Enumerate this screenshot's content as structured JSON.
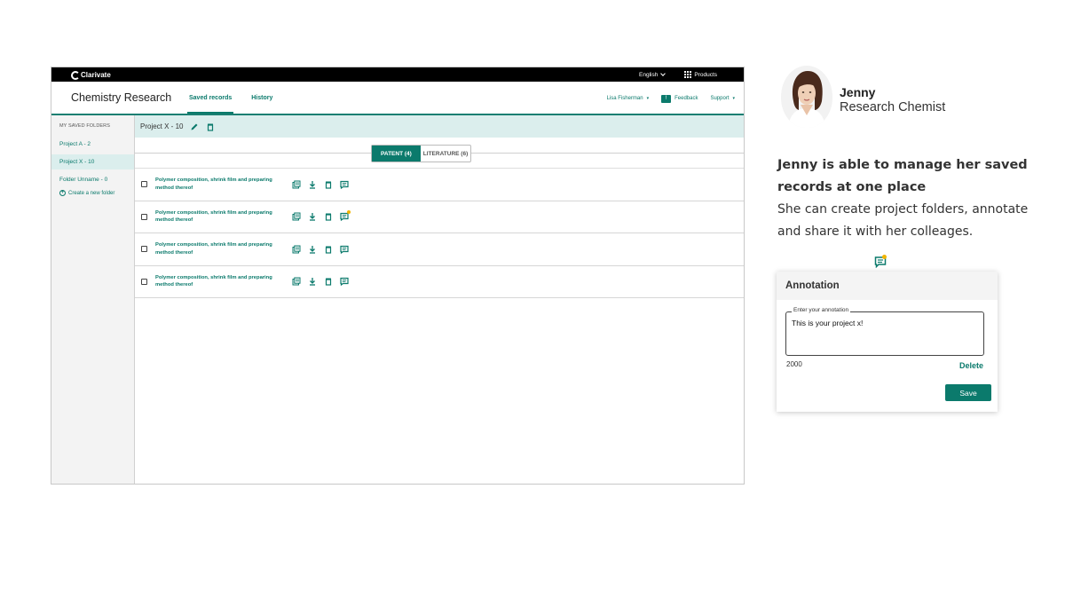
{
  "app": {
    "brand": "Clarivate",
    "language": "English",
    "products": "Products",
    "title": "Chemistry Research",
    "tabs": [
      {
        "label": "Saved records",
        "active": true
      },
      {
        "label": "History",
        "active": false
      }
    ],
    "user": "Lisa Fisherman",
    "feedback": "Feedback",
    "support": "Support"
  },
  "sidebar": {
    "heading": "MY SAVED FOLDERS",
    "items": [
      {
        "label": "Project A - 2",
        "active": false
      },
      {
        "label": "Project X - 10",
        "active": true
      },
      {
        "label": "Folder Unname - 0",
        "active": false
      }
    ],
    "create": "Create a new folder"
  },
  "main": {
    "project": "Project X - 10",
    "segments": [
      {
        "label": "PATENT (4)",
        "active": true
      },
      {
        "label": "LITERATURE (6)",
        "active": false
      }
    ],
    "records": [
      {
        "title": "Polymer composition, shrink film and preparing method thereof",
        "annotated": false
      },
      {
        "title": "Polymer composition, shrink film and preparing method thereof",
        "annotated": true
      },
      {
        "title": "Polymer composition, shrink film and preparing method thereof",
        "annotated": false
      },
      {
        "title": "Polymer composition, shrink film and preparing method thereof",
        "annotated": false
      }
    ]
  },
  "persona": {
    "name": "Jenny",
    "role": "Research Chemist",
    "headline": "Jenny is able to manage her saved records at one place",
    "description": "She can create project folders, annotate and share it with her colleages."
  },
  "annotation": {
    "title": "Annotation",
    "label": "Enter your annotation",
    "value": "This is your project x!",
    "count": "2000",
    "delete": "Delete",
    "save": "Save"
  },
  "colors": {
    "accent": "#0b7a6c",
    "highlight": "#dbeeed",
    "notification": "#f0b400"
  }
}
